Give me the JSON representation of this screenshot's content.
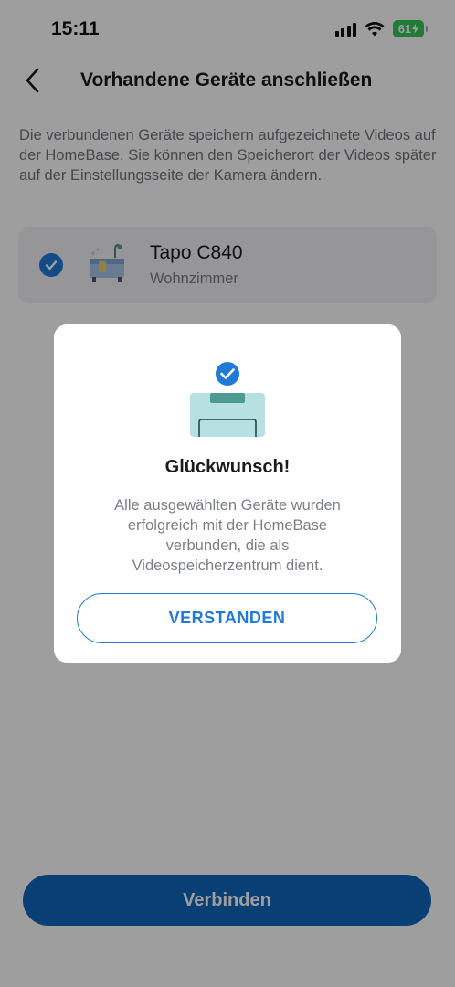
{
  "status_bar": {
    "time": "15:11",
    "battery_level": "61",
    "icons": [
      "cellular-signal-icon",
      "wifi-icon",
      "battery-charging-icon"
    ]
  },
  "header": {
    "back_icon": "chevron-left-icon",
    "title": "Vorhandene Geräte anschließen"
  },
  "description": "Die verbundenen Geräte speichern aufgezeichnete Videos auf der HomeBase. Sie können den Speicherort der Videos später auf der Einstellungsseite der Kamera ändern.",
  "devices": [
    {
      "name": "Tapo C840",
      "room": "Wohnzimmer",
      "selected": true,
      "icon": "camera-device-icon"
    }
  ],
  "connect_button": {
    "label": "Verbinden"
  },
  "dialog": {
    "icon": "homebase-success-icon",
    "title": "Glückwunsch!",
    "message": "Alle ausgewählten Geräte wurden erfolgreich mit der HomeBase verbunden, die als Videospeicherzentrum dient.",
    "button_label": "VERSTANDEN"
  },
  "colors": {
    "accent": "#1f7ad8",
    "primary_button": "#1167be",
    "battery": "#34c759",
    "overlay": "rgba(0,0,0,0.38)"
  }
}
